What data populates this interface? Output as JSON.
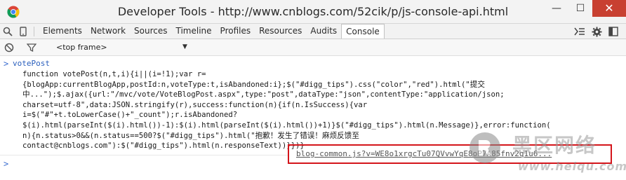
{
  "window": {
    "title": "Developer Tools - http://www.cnblogs.com/52cik/p/js-console-api.html",
    "controls": {
      "minimize": "—",
      "maximize": "☐",
      "close": "✕"
    }
  },
  "toolbar": {
    "tabs": [
      {
        "label": "Elements"
      },
      {
        "label": "Network"
      },
      {
        "label": "Sources"
      },
      {
        "label": "Timeline"
      },
      {
        "label": "Profiles"
      },
      {
        "label": "Resources"
      },
      {
        "label": "Audits"
      },
      {
        "label": "Console",
        "active": true
      }
    ],
    "icons": {
      "inspect": "search-icon",
      "device": "device-icon",
      "drawer": "show-drawer-icon",
      "settings": "gear-icon",
      "dock": "dock-icon"
    }
  },
  "filterbar": {
    "frame_selected": "<top frame>"
  },
  "console": {
    "input_expression": "votePost",
    "output_lines": [
      "function votePost(n,t,i){i||(i=!1);var r=",
      "{blogApp:currentBlogApp,postId:n,voteType:t,isAbandoned:i};$(\"#digg_tips\").css(\"color\",\"red\").html(\"提交",
      "中...\");$.ajax({url:\"/mvc/vote/VoteBlogPost.aspx\",type:\"post\",dataType:\"json\",contentType:\"application/json;",
      "charset=utf-8\",data:JSON.stringify(r),success:function(n){if(n.IsSuccess){var",
      "i=$(\"#\"+t.toLowerCase()+\"_count\");r.isAbandoned?",
      "$(i).html(parseInt($(i).html())-1):$(i).html(parseInt($(i).html())+1)}$(\"#digg_tips\").html(n.Message)},error:function(",
      "n){n.status>0&&(n.status==500?$(\"#digg_tips\").html(\"抱歉！发生了错误！麻烦反馈至",
      "contact@cnblogs.com\"):$(\"#digg_tips\").html(n.responseText))}})}"
    ],
    "source_link": "blog-common.js?v=WE8o1xrgcTu07QVvwYqE8oP7A85fnv2q1u6...",
    "prompt_symbol": ">",
    "input_marker": ">"
  },
  "watermark": {
    "brand_cn": "黑区网络",
    "url": "www.heiqu.com"
  },
  "colors": {
    "highlight_box": "#d4151b",
    "close_button": "#c84031",
    "expression_blue": "#2a5fbd"
  }
}
